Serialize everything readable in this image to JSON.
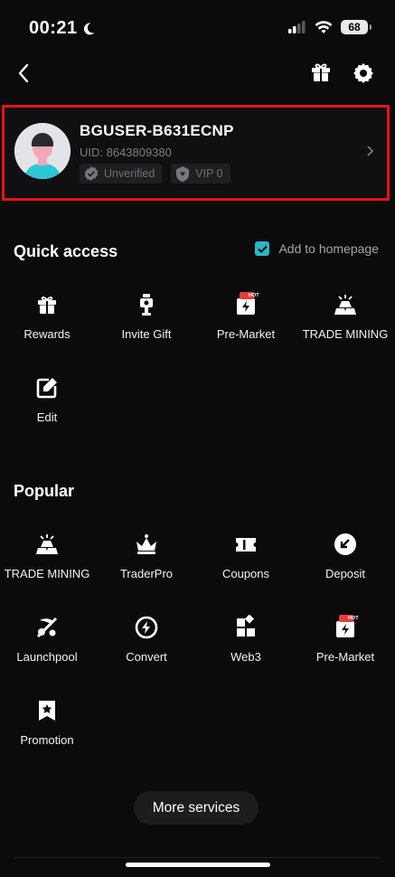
{
  "status_bar": {
    "time": "00:21",
    "battery": "68"
  },
  "icons": {
    "back": "chevron-left-icon",
    "gift": "gift-icon",
    "settings": "gear-icon",
    "verified": "verify-shield-icon",
    "vip": "vip-shield-icon",
    "chevron": "chevron-right-icon"
  },
  "profile": {
    "username": "BGUSER-B631ECNP",
    "uid": "UID: 8643809380",
    "verification_badge": "Unverified",
    "vip_badge": "VIP 0"
  },
  "quick_access": {
    "title": "Quick access",
    "add_to_homepage": "Add to homepage",
    "add_to_homepage_checked": true,
    "items": [
      {
        "label": "Rewards",
        "icon": "gift-icon"
      },
      {
        "label": "Invite Gift",
        "icon": "invite-gift-icon"
      },
      {
        "label": "Pre-Market",
        "icon": "pre-market-icon",
        "tag": "HOT"
      },
      {
        "label": "TRADE MINING",
        "icon": "trade-mining-icon"
      },
      {
        "label": "Edit",
        "icon": "edit-icon"
      }
    ]
  },
  "popular": {
    "title": "Popular",
    "items": [
      {
        "label": "TRADE MINING",
        "icon": "trade-mining-icon"
      },
      {
        "label": "TraderPro",
        "icon": "crown-icon"
      },
      {
        "label": "Coupons",
        "icon": "coupon-icon"
      },
      {
        "label": "Deposit",
        "icon": "deposit-icon"
      },
      {
        "label": "Launchpool",
        "icon": "launchpool-icon"
      },
      {
        "label": "Convert",
        "icon": "convert-icon"
      },
      {
        "label": "Web3",
        "icon": "web3-icon"
      },
      {
        "label": "Pre-Market",
        "icon": "pre-market-icon",
        "tag": "HOT"
      },
      {
        "label": "Promotion",
        "icon": "promotion-icon"
      }
    ]
  },
  "more_services": "More services",
  "colors": {
    "background": "#0b0b0c",
    "highlight_border": "#e3141b",
    "accent": "#2bb4c6",
    "hot_tag": "#e43d3d"
  }
}
